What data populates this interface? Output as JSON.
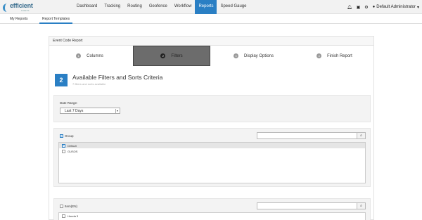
{
  "logo": {
    "word": "efficient",
    "sub": "FLEETS"
  },
  "nav": {
    "items": [
      "Dashboard",
      "Tracking",
      "Routing",
      "Geofence",
      "Workflow",
      "Reports",
      "Speed Gauge"
    ],
    "active_index": 5
  },
  "header_right": {
    "user_label": "Default Administrator"
  },
  "subnav": {
    "tabs": [
      "My Reports",
      "Report Templates"
    ],
    "active_index": 1
  },
  "panel": {
    "title": "Event Code Report",
    "steps": [
      {
        "num": "1",
        "label": "Columns"
      },
      {
        "num": "2",
        "label": "Filters"
      },
      {
        "num": "3",
        "label": "Display Options"
      },
      {
        "num": "4",
        "label": "Finish Report"
      }
    ],
    "active_step": 1
  },
  "section": {
    "num": "2",
    "title": "Available Filters and Sorts Criteria",
    "subtitle": "7 filters and sorts available"
  },
  "date_range": {
    "label": "Date Range:",
    "value": "Last 7 Days"
  },
  "group_filter": {
    "header": "Group",
    "header_checked": true,
    "search_placeholder": "",
    "options": [
      {
        "label": "Default",
        "checked": true,
        "selected": true
      },
      {
        "label": "GUSOS",
        "checked": false,
        "selected": false
      }
    ]
  },
  "item_filter": {
    "header": "Item(EN)",
    "header_checked": false,
    "search_placeholder": "",
    "options": [
      {
        "label": "Honda 3",
        "checked": false,
        "selected": false
      }
    ]
  },
  "colors": {
    "accent": "#2a7fc4",
    "active_step_bg": "#6c6c6c"
  }
}
